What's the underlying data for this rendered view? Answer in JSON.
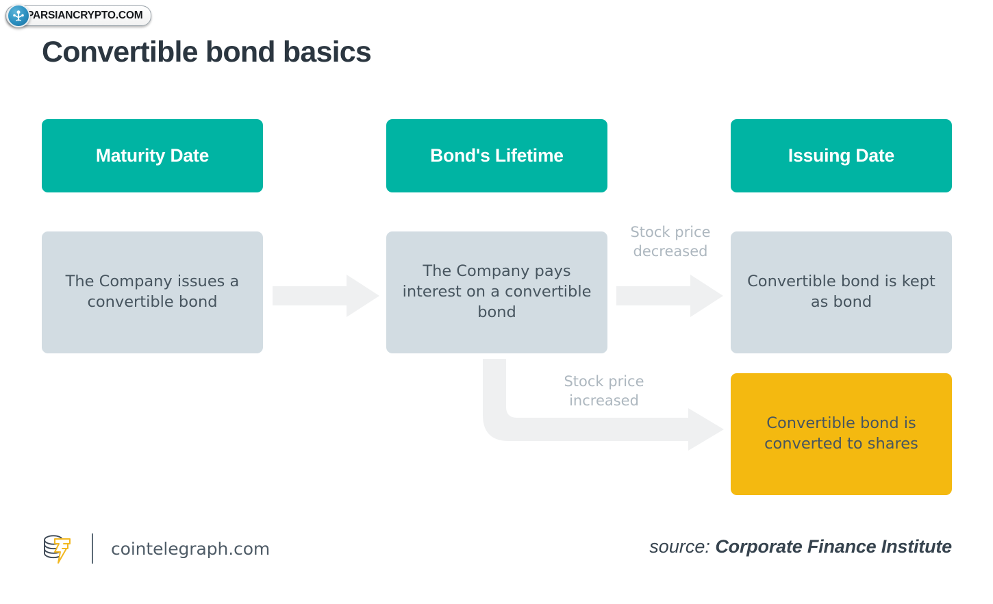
{
  "watermark": {
    "text": "PARSIANCRYPTO.COM",
    "icon": "network-tree-icon",
    "badge_color": "#2b8fc0"
  },
  "title": "Convertible bond basics",
  "colors": {
    "header_teal": "#00b4a3",
    "body_gray": "#d2dce2",
    "highlight_yellow": "#f4b910",
    "arrow_gray": "#eff0f1",
    "text_dark": "#47555f",
    "label_gray": "#adb7bf",
    "title_dark": "#2b3640"
  },
  "columns": [
    {
      "header": "Maturity Date"
    },
    {
      "header": "Bond's Lifetime"
    },
    {
      "header": "Issuing Date"
    }
  ],
  "stages": [
    {
      "id": "stage-issue",
      "text": "The Company issues a convertible bond",
      "style": "gray"
    },
    {
      "id": "stage-interest",
      "text": "The Company pays interest on a convertible bond",
      "style": "gray"
    },
    {
      "id": "outcome-kept",
      "text": "Convertible bond is kept as bond",
      "style": "gray"
    },
    {
      "id": "outcome-converted",
      "text": "Convertible bond is converted to shares",
      "style": "yellow"
    }
  ],
  "arrow_labels": [
    {
      "id": "label-decreased",
      "text": "Stock price decreased"
    },
    {
      "id": "label-increased",
      "text": "Stock price increased"
    }
  ],
  "footer": {
    "brand_icon": "cointelegraph-coin-bolt-icon",
    "site": "cointelegraph.com",
    "source_word": "source:",
    "source_name": "Corporate Finance Institute"
  }
}
